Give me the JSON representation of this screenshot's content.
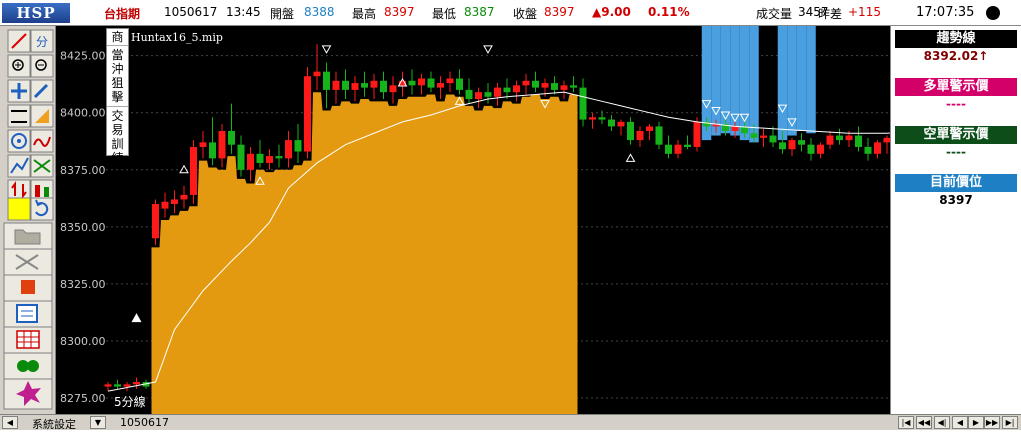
{
  "header": {
    "logo": "HSP",
    "instrument": "台指期",
    "date": "1050617",
    "time": "13:45",
    "open_label": "開盤",
    "open_value": "8388",
    "high_label": "最高",
    "high_value": "8397",
    "low_label": "最低",
    "low_value": "8387",
    "close_label": "收盤",
    "close_value": "8397",
    "change": "▲9.00",
    "change_pct": "0.11%",
    "volume_label": "成交量",
    "volume_value": "3457",
    "diff_label": "昨差",
    "diff_value": "+115",
    "clock": "17:07:35"
  },
  "side_tabs": [
    "商",
    "當沖狙擊",
    "交易訓練"
  ],
  "chart": {
    "indicator_file": "Huntax16_5.mip",
    "timeframe_label": "5分線",
    "y_ticks": [
      "8425.00",
      "8400.00",
      "8375.00",
      "8350.00",
      "8325.00",
      "8300.00",
      "8275.00"
    ],
    "colors": {
      "up": "#ff1a1a",
      "down": "#17b31a",
      "orange_zone": "#e39a10",
      "blue_zone": "#4a9fe0",
      "trend_line": "#ffffff",
      "background": "#000000"
    }
  },
  "chart_data": {
    "type": "candlestick",
    "y_range": [
      8268,
      8438
    ],
    "y_ticks": [
      8425,
      8400,
      8375,
      8350,
      8325,
      8300,
      8275
    ],
    "candles": [
      [
        8280,
        8282,
        8278,
        8281
      ],
      [
        8281,
        8283,
        8279,
        8280
      ],
      [
        8280,
        8282,
        8278,
        8281
      ],
      [
        8281,
        8284,
        8279,
        8282
      ],
      [
        8282,
        8283,
        8279,
        8280
      ],
      [
        8345,
        8362,
        8342,
        8360
      ],
      [
        8358,
        8365,
        8354,
        8361
      ],
      [
        8360,
        8366,
        8356,
        8362
      ],
      [
        8362,
        8368,
        8358,
        8364
      ],
      [
        8364,
        8388,
        8360,
        8385
      ],
      [
        8385,
        8392,
        8380,
        8387
      ],
      [
        8387,
        8398,
        8377,
        8380
      ],
      [
        8380,
        8395,
        8376,
        8392
      ],
      [
        8392,
        8404,
        8382,
        8386
      ],
      [
        8386,
        8390,
        8372,
        8375
      ],
      [
        8375,
        8385,
        8370,
        8382
      ],
      [
        8382,
        8388,
        8376,
        8378
      ],
      [
        8378,
        8384,
        8375,
        8381
      ],
      [
        8381,
        8386,
        8376,
        8380
      ],
      [
        8380,
        8392,
        8376,
        8388
      ],
      [
        8388,
        8395,
        8378,
        8383
      ],
      [
        8383,
        8420,
        8380,
        8416
      ],
      [
        8416,
        8430,
        8410,
        8418
      ],
      [
        8418,
        8422,
        8402,
        8410
      ],
      [
        8410,
        8418,
        8404,
        8414
      ],
      [
        8414,
        8419,
        8406,
        8410
      ],
      [
        8410,
        8416,
        8405,
        8413
      ],
      [
        8413,
        8418,
        8407,
        8411
      ],
      [
        8411,
        8417,
        8406,
        8414
      ],
      [
        8414,
        8418,
        8406,
        8409
      ],
      [
        8409,
        8416,
        8404,
        8412
      ],
      [
        8412,
        8418,
        8407,
        8414
      ],
      [
        8414,
        8419,
        8408,
        8412
      ],
      [
        8412,
        8417,
        8408,
        8415
      ],
      [
        8415,
        8418,
        8409,
        8411
      ],
      [
        8411,
        8416,
        8406,
        8413
      ],
      [
        8413,
        8418,
        8409,
        8415
      ],
      [
        8415,
        8419,
        8408,
        8410
      ],
      [
        8410,
        8415,
        8404,
        8406
      ],
      [
        8406,
        8411,
        8402,
        8409
      ],
      [
        8409,
        8413,
        8404,
        8407
      ],
      [
        8407,
        8413,
        8403,
        8411
      ],
      [
        8411,
        8415,
        8406,
        8409
      ],
      [
        8409,
        8414,
        8405,
        8412
      ],
      [
        8412,
        8417,
        8408,
        8414
      ],
      [
        8414,
        8418,
        8409,
        8411
      ],
      [
        8411,
        8415,
        8407,
        8413
      ],
      [
        8413,
        8416,
        8408,
        8410
      ],
      [
        8410,
        8414,
        8406,
        8412
      ],
      [
        8412,
        8416,
        8409,
        8411
      ],
      [
        8411,
        8415,
        8394,
        8397
      ],
      [
        8397,
        8400,
        8393,
        8398
      ],
      [
        8398,
        8401,
        8395,
        8397
      ],
      [
        8397,
        8399,
        8392,
        8394
      ],
      [
        8394,
        8397,
        8390,
        8396
      ],
      [
        8396,
        8398,
        8386,
        8388
      ],
      [
        8388,
        8394,
        8385,
        8392
      ],
      [
        8392,
        8395,
        8388,
        8394
      ],
      [
        8394,
        8396,
        8384,
        8386
      ],
      [
        8386,
        8390,
        8380,
        8382
      ],
      [
        8382,
        8388,
        8380,
        8386
      ],
      [
        8386,
        8390,
        8384,
        8385
      ],
      [
        8385,
        8398,
        8383,
        8396
      ],
      [
        8396,
        8398,
        8392,
        8394
      ],
      [
        8394,
        8397,
        8391,
        8395
      ],
      [
        8395,
        8398,
        8390,
        8392
      ],
      [
        8392,
        8396,
        8389,
        8394
      ],
      [
        8394,
        8397,
        8389,
        8391
      ],
      [
        8391,
        8395,
        8387,
        8389
      ],
      [
        8389,
        8393,
        8385,
        8390
      ],
      [
        8390,
        8394,
        8385,
        8387
      ],
      [
        8387,
        8392,
        8382,
        8384
      ],
      [
        8384,
        8389,
        8381,
        8388
      ],
      [
        8388,
        8391,
        8383,
        8386
      ],
      [
        8386,
        8389,
        8379,
        8382
      ],
      [
        8382,
        8387,
        8380,
        8386
      ],
      [
        8386,
        8392,
        8384,
        8390
      ],
      [
        8390,
        8393,
        8386,
        8388
      ],
      [
        8388,
        8392,
        8385,
        8390
      ],
      [
        8390,
        8394,
        8383,
        8385
      ],
      [
        8385,
        8389,
        8379,
        8382
      ],
      [
        8382,
        8388,
        8380,
        8387
      ],
      [
        8387,
        8390,
        8382,
        8389
      ],
      [
        8389,
        8398,
        8386,
        8397
      ]
    ],
    "trend": [
      [
        0,
        8278
      ],
      [
        5,
        8282
      ],
      [
        7,
        8305
      ],
      [
        10,
        8322
      ],
      [
        13,
        8335
      ],
      [
        15,
        8343
      ],
      [
        17,
        8352
      ],
      [
        19,
        8367
      ],
      [
        22,
        8378
      ],
      [
        25,
        8386
      ],
      [
        28,
        8391
      ],
      [
        31,
        8396
      ],
      [
        34,
        8399
      ],
      [
        37,
        8403
      ],
      [
        40,
        8406
      ],
      [
        42,
        8407
      ],
      [
        45,
        8408
      ],
      [
        48,
        8409
      ],
      [
        50,
        8407
      ],
      [
        52,
        8405
      ],
      [
        54,
        8403
      ],
      [
        56,
        8401
      ],
      [
        59,
        8398
      ],
      [
        62,
        8396
      ],
      [
        66,
        8394
      ],
      [
        70,
        8393
      ],
      [
        74,
        8392
      ],
      [
        78,
        8391
      ],
      [
        82,
        8391
      ],
      [
        85,
        8392
      ]
    ],
    "orange_zone": [
      5,
      49
    ],
    "blue_zones": [
      [
        63,
        68
      ],
      [
        71,
        74
      ]
    ],
    "blue_bottoms": [
      8388,
      8390,
      8391,
      8390,
      8388,
      8387,
      8388,
      8390,
      8392,
      8391,
      8389,
      8390
    ],
    "up_markers": [
      [
        8,
        8375
      ],
      [
        16,
        8370
      ],
      [
        37,
        8405
      ],
      [
        55,
        8380
      ],
      [
        31,
        8413
      ]
    ],
    "down_markers": [
      [
        23,
        8428
      ],
      [
        40,
        8428
      ],
      [
        46,
        8404
      ],
      [
        63,
        8404
      ],
      [
        64,
        8401
      ],
      [
        65,
        8399
      ],
      [
        66,
        8398
      ],
      [
        67,
        8398
      ],
      [
        71,
        8402
      ],
      [
        72,
        8396
      ]
    ],
    "white_up_marker": [
      3,
      8310
    ]
  },
  "right_panel": {
    "trend_label": "趨勢線",
    "trend_value": "8392.02↑",
    "bull_label": "多單警示價",
    "bull_value": "----",
    "bear_label": "空單警示價",
    "bear_value": "----",
    "position_label": "目前價位",
    "position_value": "8397",
    "colors": {
      "trend": "#000000",
      "bull": "#d4006a",
      "bear": "#0d4d1a",
      "position": "#1e7fc4",
      "trend_value": "#800000"
    }
  },
  "footer": {
    "settings_label": "系統設定",
    "date": "1050617"
  }
}
